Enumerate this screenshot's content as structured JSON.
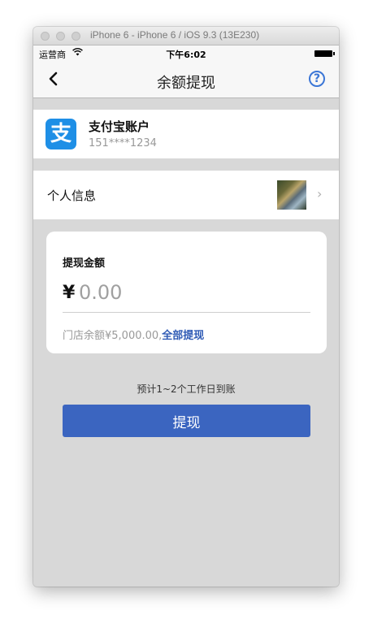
{
  "window": {
    "title": "iPhone 6 - iPhone 6 / iOS 9.3 (13E230)"
  },
  "status_bar": {
    "carrier": "运营商",
    "time": "下午6:02"
  },
  "nav": {
    "title": "余额提现",
    "help_symbol": "?"
  },
  "account": {
    "logo_glyph": "支",
    "name": "支付宝账户",
    "number": "151****1234"
  },
  "personal_info": {
    "label": "个人信息",
    "chevron": "›"
  },
  "withdraw_card": {
    "title": "提现金额",
    "currency_symbol": "¥",
    "amount_placeholder": "0.00",
    "balance_text": "门店余额¥5,000.00,",
    "withdraw_all_label": "全部提现"
  },
  "eta_note": "预计1~2个工作日到账",
  "submit_button_label": "提现",
  "colors": {
    "accent": "#3b65c0",
    "link": "#2f5bb5",
    "alipay_blue": "#1e8fe6",
    "background": "#d8d8d8"
  },
  "icons": [
    "back-icon",
    "help-icon",
    "wifi-icon",
    "battery-icon",
    "alipay-logo",
    "chevron-right-icon"
  ]
}
